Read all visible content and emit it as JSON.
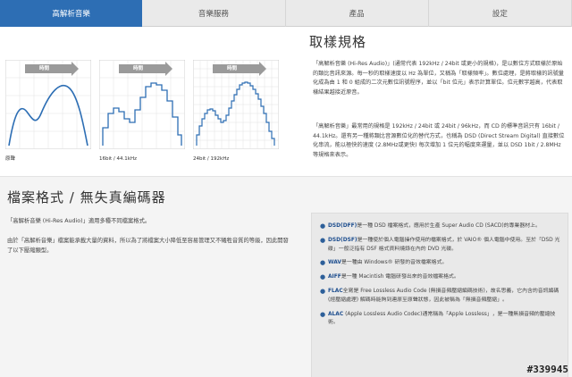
{
  "tabs": [
    {
      "label": "高解析音樂",
      "active": true
    },
    {
      "label": "音樂服務",
      "active": false
    },
    {
      "label": "產品",
      "active": false
    },
    {
      "label": "設定",
      "active": false
    }
  ],
  "sampling": {
    "title": "取樣規格",
    "graphs": [
      {
        "time_label": "時間",
        "caption": "原聲"
      },
      {
        "time_label": "時間",
        "caption": "16bit / 44.1kHz"
      },
      {
        "time_label": "時間",
        "caption": "24bit / 192kHz"
      }
    ],
    "paragraph1": "「高解析音樂 (Hi-Res Audio)」(通常代表 192kHz / 24bit 或更小的規格)，是以數位方式取樣於原始的類比音訊來源。每一秒的取樣速度以 Hz 為單位，又稱為「取樣頻率」。數位處理，是將取樣的訊號量化成為由 1 和 0 組成的二次元數位訊號程序，並以「bit 位元」表示計算單位。位元數字越高，代表取樣結果越接近原音。",
    "paragraph2": "「高解析音樂」最常用的規格是 192kHz / 24bit 或 24bit / 96kHz，而 CD 的標準音訊只有 16bit / 44.1kHz。還有另一種將類比音源數位化的替代方式，也稱為 DSD (Direct Stream Digital) 直接數位化串流，能以極快的速度 (2.8MHz或更快) 每次增加 1 位元的幅度來運量，並以 DSD 1bit / 2.8MHz 等規格來表示。"
  },
  "formats": {
    "title": "檔案格式 / 無失真編碼器",
    "intro1": "「高解析音樂 (Hi-Res Audio)」適用多種不同檔案格式。",
    "intro2": "由於「高解析音樂」檔案能承載大量的資料，所以為了將檔案大小降低至容易管理又不犧牲音質的等級，因此開發了以下壓縮類型。",
    "items": [
      {
        "name": "DSD(DFF)",
        "desc": "是一種 DSD 檔案格式，應用於生產 Super Audio CD (SACD)的專業器材上。"
      },
      {
        "name": "DSD(DSF)",
        "desc": "是一種使於個人電腦操作使用的檔案格式，於 VAIO® 個人電腦中使用。至於「DSD 光碟」一般泛指有 DSF 格式資料燒錄在內的 DVD 光碟。"
      },
      {
        "name": "WAV",
        "desc": "是一種由 Windows® 研發的音效檔案格式。"
      },
      {
        "name": "AIFF",
        "desc": "是一種 Macintish 電腦研發出來的音效檔案格式。"
      },
      {
        "name": "FLAC",
        "desc": "全寫是 Free Lossless Audio Code (無損音頻壓縮編碼技術)，故名思義，它內含的音訊編碼 (經壓縮處理) 解碼時能夠到連原至原聲狀態，因此被稱為「無損音頻壓縮」。"
      },
      {
        "name": "ALAC",
        "desc": " (Apple Lossless Audio Codec)通常稱為「Apple Lossless」，是一種無損音頻的壓縮技術。"
      }
    ]
  },
  "watermark": "#339945",
  "colors": {
    "accent": "#2d6eb4",
    "link": "#1f4f8f"
  }
}
